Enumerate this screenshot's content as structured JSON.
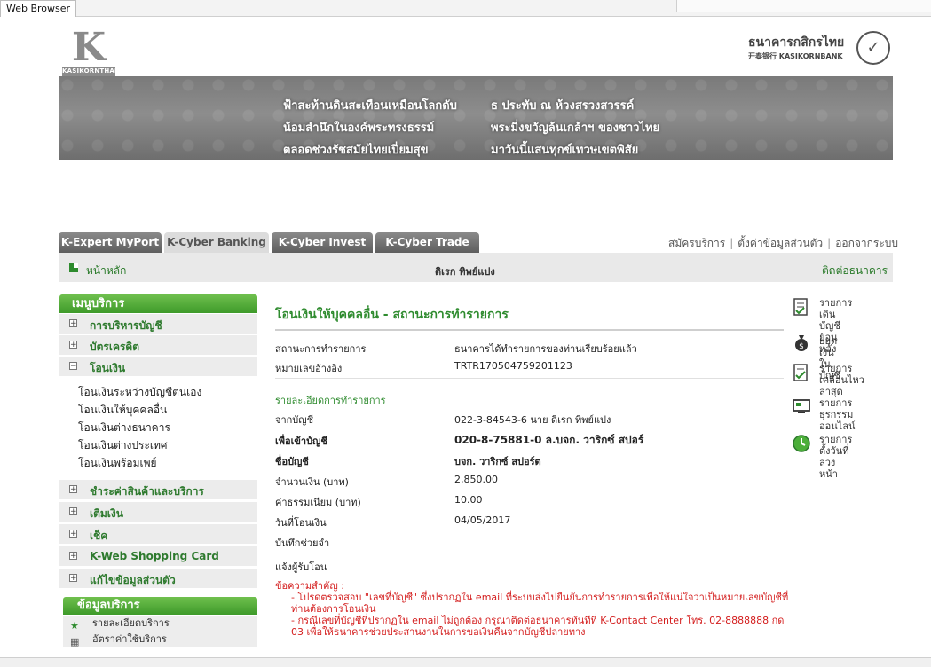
{
  "browser": {
    "tab_label": "Web Browser"
  },
  "branding": {
    "left_logo_letter": "K",
    "left_logo_text": "KASIKORNTHAI",
    "bank_name_th": "ธนาคารกสิกรไทย",
    "bank_name_en": "开泰银行 KASIKORNBANK"
  },
  "banner": {
    "poem_left": [
      "ฟ้าสะท้านดินสะเทือนเหมือนโลกดับ",
      "น้อมสำนึกในองค์พระทรงธรรม์",
      "ตลอดช่วงรัชสมัยไทยเปี่ยมสุข"
    ],
    "poem_right": [
      "ธ ประทับ ณ ห้วงสรวงสวรรค์",
      "พระมิ่งขวัญล้นเกล้าฯ ของชาวไทย",
      "มาวันนี้แสนทุกข์เทวษเขตพิสัย"
    ]
  },
  "tabs": [
    "K-Expert MyPort",
    "K-Cyber Banking",
    "K-Cyber Invest",
    "K-Cyber Trade"
  ],
  "top_links": [
    "สมัครบริการ",
    "ตั้งค่าข้อมูลส่วนตัว",
    "ออกจากระบบ"
  ],
  "header_bar": {
    "home": "หน้าหลัก",
    "user": "ดิเรก ทิพย์แปง",
    "contact": "ติดต่อธนาคาร"
  },
  "menu": {
    "title": "เมนูบริการ",
    "groups": [
      {
        "label": "การบริหารบัญชี",
        "sign": "+"
      },
      {
        "label": "บัตรเครดิต",
        "sign": "+"
      },
      {
        "label": "โอนเงิน",
        "sign": "−"
      }
    ],
    "transfer_sub": [
      "โอนเงินระหว่างบัญชีตนเอง",
      "โอนเงินให้บุคคลอื่น",
      "โอนเงินต่างธนาคาร",
      "โอนเงินต่างประเทศ",
      "โอนเงินพร้อมเพย์"
    ],
    "groups_after": [
      {
        "label": "ชำระค่าสินค้าและบริการ",
        "sign": "+"
      },
      {
        "label": "เติมเงิน",
        "sign": "+"
      },
      {
        "label": "เช็ค",
        "sign": "+"
      },
      {
        "label": "K-Web Shopping Card",
        "sign": "+"
      },
      {
        "label": "แก้ไขข้อมูลส่วนตัว",
        "sign": "+"
      }
    ]
  },
  "service_info": {
    "title": "ข้อมูลบริการ",
    "items": [
      "รายละเอียดบริการ",
      "อัตราค่าใช้บริการ"
    ]
  },
  "main": {
    "title": "โอนเงินให้บุคคลอื่น - สถานะการทำรายการ",
    "status_label": "สถานะการทำรายการ",
    "status_value": "ธนาคารได้ทำรายการของท่านเรียบร้อยแล้ว",
    "ref_label": "หมายเลขอ้างอิง",
    "ref_value": "TRTR170504759201123",
    "detail_title": "รายละเอียดการทำรายการ",
    "from_label": "จากบัญชี",
    "from_value": "022-3-84543-6 นาย ดิเรก ทิพย์แปง",
    "to_label": "เพื่อเข้าบัญชี",
    "to_value": "020-8-75881-0 ล.บจก. วาริกซ์ สปอร์",
    "name_label": "ชื่อบัญชี",
    "name_value": "บจก. วาริกซ์ สปอร์ต",
    "amount_label": "จำนวนเงิน (บาท)",
    "amount_value": "2,850.00",
    "fee_label": "ค่าธรรมเนียม (บาท)",
    "fee_value": "10.00",
    "date_label": "วันที่โอนเงิน",
    "date_value": "04/05/2017",
    "memo_label": "บันทึกช่วยจำ",
    "notify_label": "แจ้งผู้รับโอน",
    "notice_title": "ข้อความสำคัญ :",
    "notice_1": "- โปรดตรวจสอบ \"เลขที่บัญชี\" ซึ่งปรากฏใน email ที่ระบบส่งไปยืนยันการทำรายการเพื่อให้แน่ใจว่าเป็นหมายเลขบัญชีที่ท่านต้องการโอนเงิน",
    "notice_2": "- กรณีเลขที่บัญชีที่ปรากฏใน email ไม่ถูกต้อง กรุณาติดต่อธนาคารทันทีที่ K-Contact Center โทร. 02-8888888 กด 03 เพื่อให้ธนาคารช่วยประสานงานในการขอเงินคืนจากบัญชีปลายทาง"
  },
  "right_links": [
    {
      "lines": [
        "รายการเดิน",
        "บัญชีย้อนหลัง"
      ],
      "icon": "statement-icon"
    },
    {
      "lines": [
        "ยอดเงินในบัญชี"
      ],
      "icon": "money-bag-icon"
    },
    {
      "lines": [
        "รายการ",
        "เคลื่อนไหวล่าสุด"
      ],
      "icon": "recent-check-icon"
    },
    {
      "lines": [
        "รายการ",
        "ธุรกรรมออนไลน์"
      ],
      "icon": "monitor-icon"
    },
    {
      "lines": [
        "รายการตั้งวันที่",
        "ล่วงหน้า"
      ],
      "icon": "clock-icon"
    }
  ]
}
